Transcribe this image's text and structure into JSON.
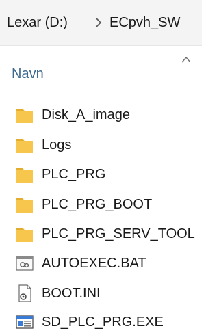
{
  "breadcrumb": {
    "drive": "Lexar (D:)",
    "separator_icon": "chevron-right-icon",
    "folder": "ECpvh_SW"
  },
  "columns": {
    "name_header": "Navn",
    "sort_icon": "chevron-up-icon"
  },
  "colors": {
    "folder": "#f6c64d",
    "folder_shade": "#e3ad2d",
    "header_text": "#3d6a8f"
  },
  "files": [
    {
      "name": "Disk_A_image",
      "icon": "folder-icon"
    },
    {
      "name": "Logs",
      "icon": "folder-icon"
    },
    {
      "name": "PLC_PRG",
      "icon": "folder-icon"
    },
    {
      "name": "PLC_PRG_BOOT",
      "icon": "folder-icon"
    },
    {
      "name": "PLC_PRG_SERV_TOOL",
      "icon": "folder-icon"
    },
    {
      "name": "AUTOEXEC.BAT",
      "icon": "batch-file-icon"
    },
    {
      "name": "BOOT.INI",
      "icon": "settings-file-icon"
    },
    {
      "name": "SD_PLC_PRG.EXE",
      "icon": "application-icon"
    }
  ]
}
